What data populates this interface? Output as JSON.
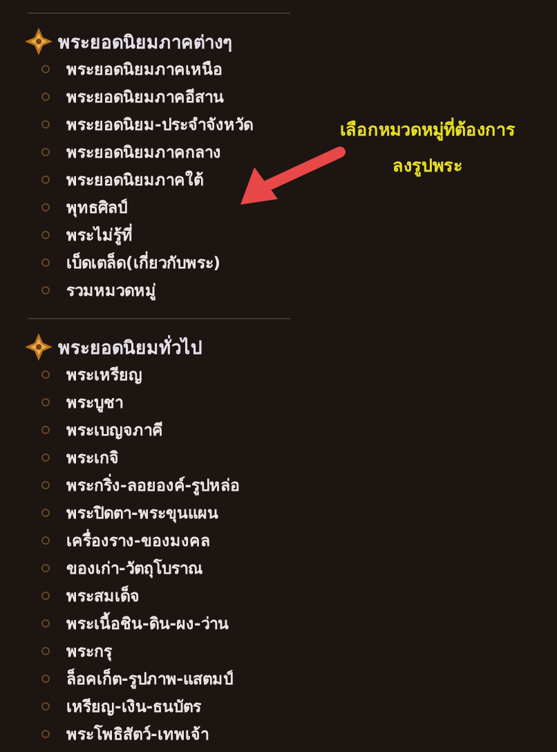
{
  "sections": [
    {
      "title": "พระยอดนิยมภาคต่างๆ",
      "items": [
        "พระยอดนิยมภาคเหนือ",
        "พระยอดนิยมภาคอีสาน",
        "พระยอดนิยม-ประจำจังหวัด",
        "พระยอดนิยมภาคกลาง",
        "พระยอดนิยมภาคใต้",
        "พุทธศิลป์",
        "พระไม่รู้ที่",
        "เบ็ดเตล็ด(เกี่ยวกับพระ)",
        "รวมหมวดหมู่"
      ]
    },
    {
      "title": "พระยอดนิยมทั่วไป",
      "items": [
        "พระเหรียญ",
        "พระบูชา",
        "พระเบญจภาคี",
        "พระเกจิ",
        "พระกริ่ง-ลอยองค์-รูปหล่อ",
        "พระปิดตา-พระขุนแผน",
        "เครื่องราง-ของมงคล",
        "ของเก่า-วัตถุโบราณ",
        "พระสมเด็จ",
        "พระเนื้อชิน-ดิน-ผง-ว่าน",
        "พระกรุ",
        "ล็อคเก็ต-รูปภาพ-แสตมป์",
        "เหรียญ-เงิน-ธนบัตร",
        "พระโพธิสัตว์-เทพเจ้า"
      ]
    }
  ],
  "annotation": {
    "lines": [
      "เลือกหมวดหมู่ที่ต้องการ",
      "ลงรูปพระ"
    ]
  }
}
